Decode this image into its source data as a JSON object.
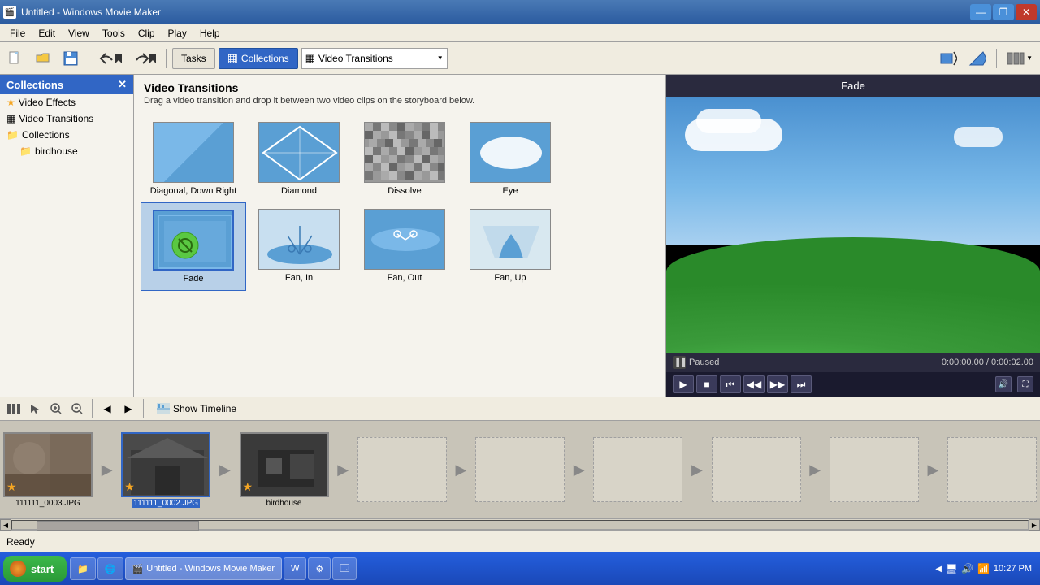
{
  "titleBar": {
    "title": "Untitled - Windows Movie Maker",
    "icon": "🎬"
  },
  "menuBar": {
    "items": [
      "File",
      "Edit",
      "View",
      "Tools",
      "Clip",
      "Play",
      "Help"
    ]
  },
  "toolbar": {
    "tasksLabel": "Tasks",
    "collectionsLabel": "Collections",
    "dropdownValue": "Video Transitions"
  },
  "leftPanel": {
    "header": "Collections",
    "closeBtn": "✕",
    "items": [
      {
        "label": "Video Effects",
        "icon": "★",
        "type": "star"
      },
      {
        "label": "Video Transitions",
        "icon": "▦",
        "type": "icon"
      },
      {
        "label": "Collections",
        "icon": "📁",
        "type": "folder"
      },
      {
        "label": "birdhouse",
        "icon": "📁",
        "type": "folder",
        "indent": true
      }
    ]
  },
  "transitionsPanel": {
    "title": "Video Transitions",
    "description": "Drag a video transition and drop it between two video clips on the storyboard below.",
    "transitions": [
      {
        "name": "Diagonal, Down Right",
        "type": "diagonal"
      },
      {
        "name": "Diamond",
        "type": "diamond"
      },
      {
        "name": "Dissolve",
        "type": "dissolve"
      },
      {
        "name": "Eye",
        "type": "eye"
      },
      {
        "name": "Fade",
        "type": "fade",
        "selected": true
      },
      {
        "name": "Fan, In",
        "type": "fan-in"
      },
      {
        "name": "Fan, Out",
        "type": "fan-out"
      },
      {
        "name": "Fan, Up",
        "type": "fan-up"
      }
    ]
  },
  "previewPanel": {
    "title": "Fade",
    "status": "Paused",
    "currentTime": "0:00:00.00",
    "totalTime": "0:00:02.00",
    "timeDisplay": "0:00:00.00 / 0:00:02.00"
  },
  "bottomToolbar": {
    "showTimelineLabel": "Show Timeline"
  },
  "storyboard": {
    "clips": [
      {
        "label": "111111_0003.JPG",
        "type": "bird",
        "selected": false
      },
      {
        "label": "111111_0002.JPG",
        "type": "house",
        "selected": true
      },
      {
        "label": "birdhouse",
        "type": "dark",
        "selected": false
      }
    ]
  },
  "statusBar": {
    "text": "Ready"
  },
  "taskbar": {
    "startLabel": "start",
    "activeWindow": "Untitled - Windows Movie Maker",
    "time": "10:27 PM",
    "trayIcons": [
      "🔼",
      "🖥️",
      "🔊",
      "🌐"
    ]
  }
}
